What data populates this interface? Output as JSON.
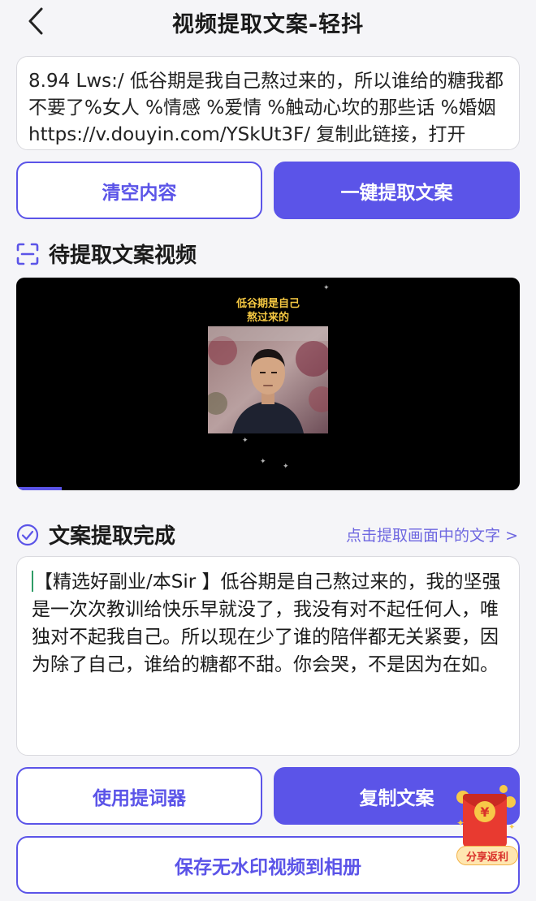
{
  "header": {
    "title": "视频提取文案-轻抖"
  },
  "input": {
    "text": "8.94 Lws:/ 低谷期是我自己熬过来的，所以谁给的糖我都不要了%女人 %情感 %爱情 %触动心坎的那些话 %婚姻  https://v.douyin.com/YSkUt3F/ 复制此链接，打开"
  },
  "actions": {
    "clear_label": "清空内容",
    "extract_label": "一键提取文案"
  },
  "video_section": {
    "title": "待提取文案视频",
    "caption_line1": "低谷期是自己",
    "caption_line2": "熬过来的",
    "progress_fraction": 0.09
  },
  "result_section": {
    "title": "文案提取完成",
    "extract_link": "点击提取画面中的文字 >",
    "text": "【精选好副业/本Sir 】低谷期是自己熬过来的，我的坚强是一次次教训给快乐早就没了，我没有对不起任何人，唯独对不起我自己。所以现在少了谁的陪伴都无关紧要，因为除了自己，谁给的糖都不甜。你会哭，不是因为在如。"
  },
  "bottom_actions": {
    "teleprompter_label": "使用提词器",
    "copy_label": "复制文案",
    "save_video_label": "保存无水印视频到相册"
  },
  "redpack": {
    "label": "分享返利",
    "symbol": "¥"
  },
  "colors": {
    "accent": "#5b54e8",
    "link": "#6e67e0"
  },
  "icons": {
    "back": "chevron-left-icon",
    "video_section": "scan-frame-icon",
    "result_section": "check-circle-icon",
    "redpack": "red-envelope-icon"
  }
}
